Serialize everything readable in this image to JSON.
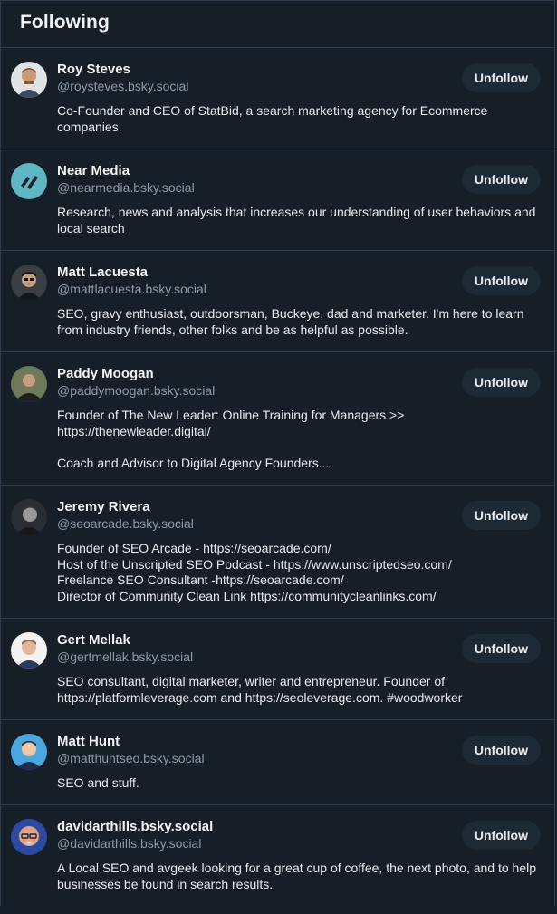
{
  "header": {
    "title": "Following"
  },
  "accounts": [
    {
      "name": "Roy Steves",
      "handle": "@roysteves.bsky.social",
      "bio": "Co-Founder and CEO of StatBid, a search marketing agency for Ecommerce companies.",
      "button": "Unfollow"
    },
    {
      "name": "Near Media",
      "handle": "@nearmedia.bsky.social",
      "bio": "Research, news and analysis that increases our understanding of user behaviors and local search",
      "button": "Unfollow"
    },
    {
      "name": "Matt Lacuesta",
      "handle": "@mattlacuesta.bsky.social",
      "bio": "SEO, gravy enthusiast, outdoorsman, Buckeye, dad and marketer. I'm here to learn from industry friends, other folks and be as helpful as possible.",
      "button": "Unfollow"
    },
    {
      "name": "Paddy Moogan",
      "handle": "@paddymoogan.bsky.social",
      "bio": "Founder of The New Leader: Online Training for Managers >>\nhttps://thenewleader.digital/\n\nCoach and Advisor to Digital Agency Founders....",
      "button": "Unfollow"
    },
    {
      "name": "Jeremy Rivera",
      "handle": "@seoarcade.bsky.social",
      "bio": "Founder of SEO Arcade - https://seoarcade.com/\nHost of the Unscripted SEO Podcast - https://www.unscriptedseo.com/\nFreelance SEO Consultant -https://seoarcade.com/\nDirector of Community Clean Link https://communitycleanlinks.com/",
      "button": "Unfollow"
    },
    {
      "name": "Gert Mellak",
      "handle": "@gertmellak.bsky.social",
      "bio": "SEO consultant, digital marketer, writer and entrepreneur. Founder of https://platformleverage.com and https://seoleverage.com. #woodworker",
      "button": "Unfollow"
    },
    {
      "name": "Matt Hunt",
      "handle": "@matthuntseo.bsky.social",
      "bio": "SEO and stuff.",
      "button": "Unfollow"
    },
    {
      "name": "davidarthills.bsky.social",
      "handle": "@davidarthills.bsky.social",
      "bio": "A Local SEO and avgeek looking for a great cup of coffee, the next photo, and to help businesses be found in search results.",
      "button": "Unfollow"
    }
  ],
  "colors": {
    "background": "#161e27",
    "button_bg": "#1e2936",
    "handle": "#8d9aa8",
    "divider": "#2e3c4b"
  }
}
